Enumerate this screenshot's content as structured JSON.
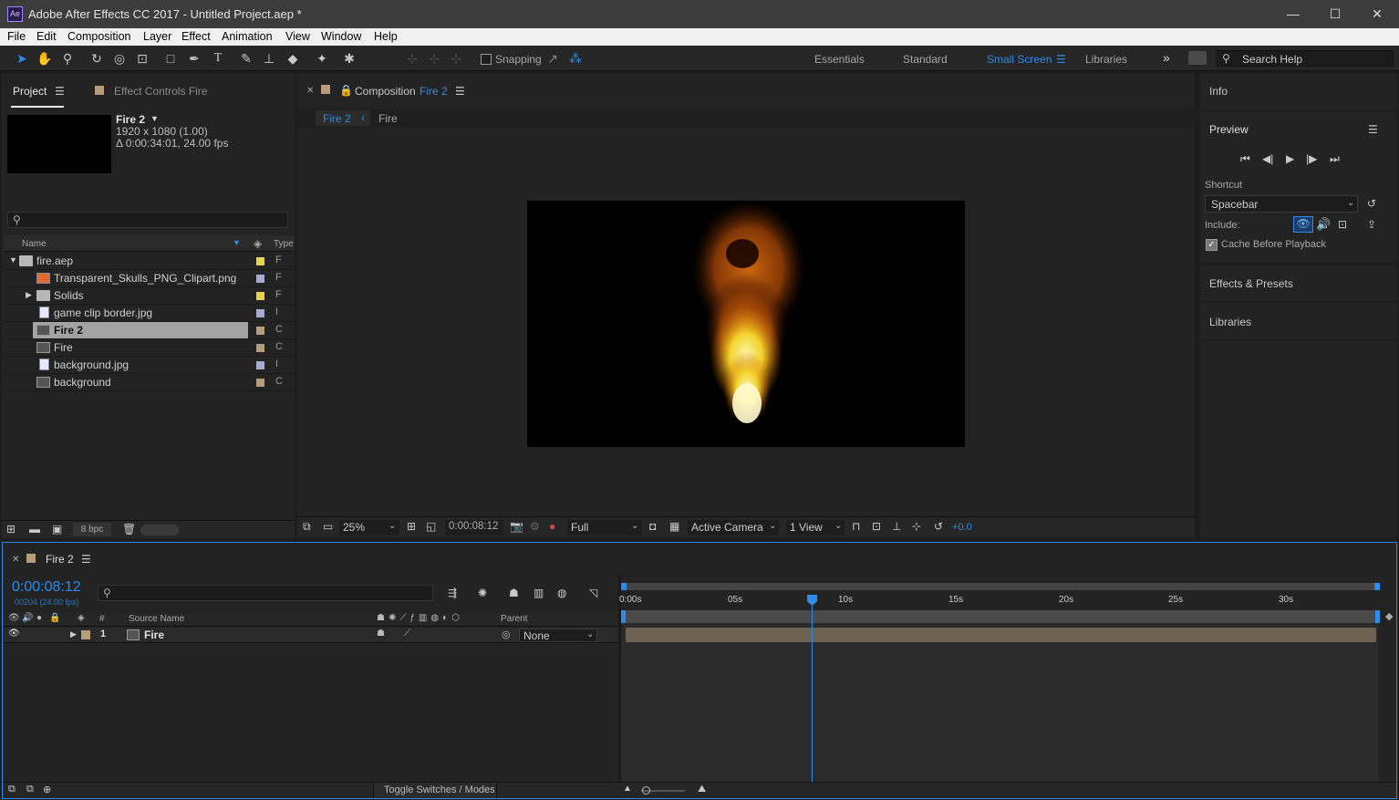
{
  "titlebar": {
    "app_icon": "Ae",
    "title": "Adobe After Effects CC 2017 - Untitled Project.aep *",
    "minimize": "—",
    "maximize": "☐",
    "close": "✕"
  },
  "menu": [
    "File",
    "Edit",
    "Composition",
    "Layer",
    "Effect",
    "Animation",
    "View",
    "Window",
    "Help"
  ],
  "toolbar": {
    "snapping_label": "Snapping",
    "workspaces": [
      "Essentials",
      "Standard",
      "Small Screen",
      "Libraries"
    ],
    "active_workspace": "Small Screen",
    "more": "»",
    "search_placeholder": "Search Help"
  },
  "project_panel": {
    "tab_project": "Project",
    "tab_effect_controls": "Effect Controls Fire",
    "selected_name": "Fire 2",
    "selected_res": "1920 x 1080 (1.00)",
    "selected_duration": "Δ 0:00:34:01, 24.00 fps",
    "col_name": "Name",
    "col_type": "Type",
    "items": [
      {
        "name": "fire.aep",
        "type": "F",
        "label_color": "#e8d24a"
      },
      {
        "name": "Transparent_Skulls_PNG_Clipart.png",
        "type": "F",
        "label_color": "#a9a9d6"
      },
      {
        "name": "Solids",
        "type": "F",
        "label_color": "#e8d24a"
      },
      {
        "name": "game clip border.jpg",
        "type": "I",
        "label_color": "#a9a9d6"
      },
      {
        "name": "Fire 2",
        "type": "C",
        "label_color": "#b89b7a"
      },
      {
        "name": "Fire",
        "type": "C",
        "label_color": "#b89b7a"
      },
      {
        "name": "background.jpg",
        "type": "I",
        "label_color": "#a9a9d6"
      },
      {
        "name": "background",
        "type": "C",
        "label_color": "#b89b7a"
      }
    ],
    "bpc": "8 bpc"
  },
  "composition_panel": {
    "tab_label": "Composition",
    "comp_name": "Fire 2",
    "breadcrumb_active": "Fire 2",
    "breadcrumb_next": "Fire",
    "zoom": "25%",
    "timecode": "0:00:08:12",
    "resolution": "Full",
    "camera": "Active Camera",
    "views": "1 View",
    "exposure": "+0.0"
  },
  "right_panel": {
    "info": "Info",
    "preview": "Preview",
    "shortcut_label": "Shortcut",
    "shortcut_value": "Spacebar",
    "include_label": "Include:",
    "cache_label": "Cache Before Playback",
    "effects_presets": "Effects & Presets",
    "libraries": "Libraries"
  },
  "timeline": {
    "comp_tab": "Fire 2",
    "timecode": "0:00:08:12",
    "frame_info": "00204 (24.00 fps)",
    "col_source": "Source Name",
    "col_parent": "Parent",
    "col_num": "#",
    "layer_num": "1",
    "layer_name": "Fire",
    "parent_value": "None",
    "ticks": [
      "0:00s",
      "05s",
      "10s",
      "15s",
      "20s",
      "25s",
      "30s"
    ],
    "toggle_label": "Toggle Switches / Modes",
    "playhead_seconds": 8.5,
    "duration_seconds": 34.04
  }
}
